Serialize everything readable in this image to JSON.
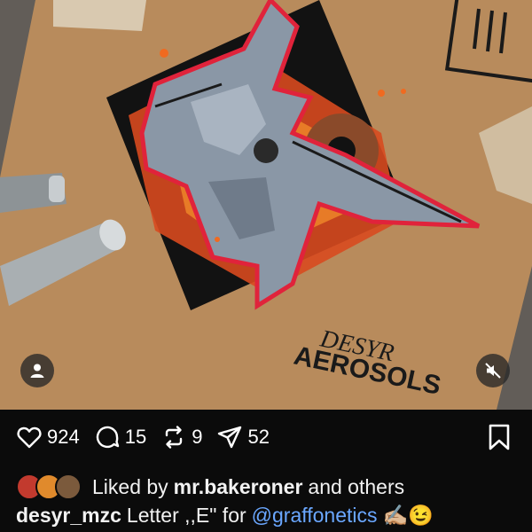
{
  "post": {
    "artwork_text": {
      "signature": "DESYR",
      "brand": "AEROSOLS"
    },
    "icons": {
      "user_tag": "person-icon",
      "mute": "speaker-muted-icon",
      "like": "heart-icon",
      "comment": "comment-bubble-icon",
      "repost": "repost-icon",
      "share": "paper-plane-icon",
      "save": "bookmark-icon"
    },
    "actions": {
      "likes_count": "924",
      "comments_count": "15",
      "reposts_count": "9",
      "shares_count": "52"
    },
    "liked_by": {
      "prefix": "Liked by",
      "user": "mr.bakeroner",
      "suffix": "and others"
    },
    "caption": {
      "username": "desyr_mzc",
      "text": "Letter ,,E\" for",
      "mention": "@graffonetics",
      "emojis": "✍🏼😉"
    },
    "colors": {
      "background": "#0b0b0b",
      "text": "#f2f2f2",
      "mention": "#6aa7ff",
      "cardboard": "#b5895a"
    }
  }
}
